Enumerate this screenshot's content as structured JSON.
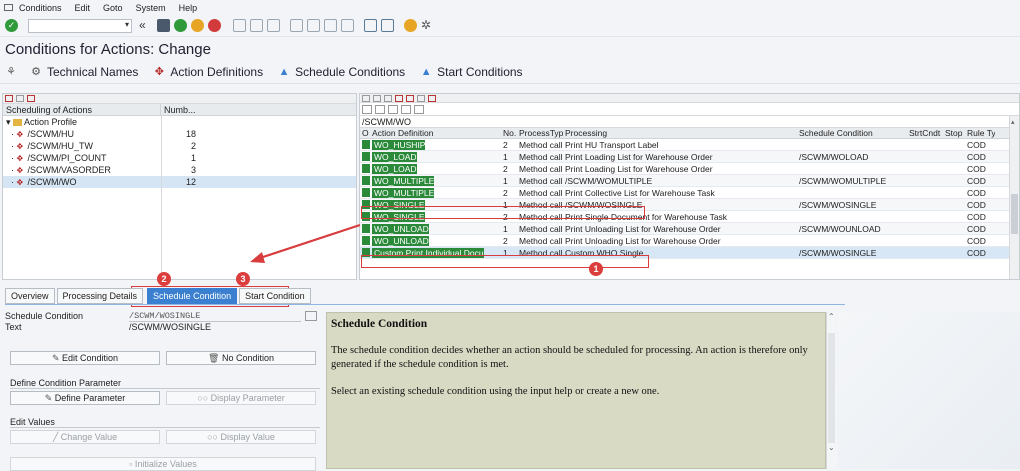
{
  "menu": [
    "Conditions",
    "Edit",
    "Goto",
    "System",
    "Help"
  ],
  "page_title": "Conditions for Actions: Change",
  "app_toolbar": [
    {
      "label": "Technical Names",
      "icon": "technical-names-icon"
    },
    {
      "label": "Action Definitions",
      "icon": "action-definitions-icon"
    },
    {
      "label": "Schedule Conditions",
      "icon": "schedule-conditions-icon"
    },
    {
      "label": "Start Conditions",
      "icon": "start-conditions-icon"
    }
  ],
  "tree": {
    "col1": "Scheduling of Actions",
    "col2": "Numb...",
    "root": "Action Profile",
    "items": [
      {
        "label": "/SCWM/HU",
        "count": "18"
      },
      {
        "label": "/SCWM/HU_TW",
        "count": "2"
      },
      {
        "label": "/SCWM/PI_COUNT",
        "count": "1"
      },
      {
        "label": "/SCWM/VASORDER",
        "count": "3"
      },
      {
        "label": "/SCWM/WO",
        "count": "12"
      }
    ]
  },
  "grid": {
    "profile": "/SCWM/WO",
    "headers": [
      "O",
      "Action Definition",
      "No.",
      "ProcessTyp",
      "Processing",
      "Schedule Condition",
      "StrtCndt",
      "Stop",
      "Rule Ty"
    ],
    "rows": [
      {
        "ad": "WO_HUSHIP",
        "no": "2",
        "pt": "Method call",
        "pr": "Print HU Transport Label",
        "sc": "",
        "rt": "COD"
      },
      {
        "ad": "WO_LOAD",
        "no": "1",
        "pt": "Method call",
        "pr": "Print Loading List for Warehouse Order",
        "sc": "/SCWM/WOLOAD",
        "rt": "COD"
      },
      {
        "ad": "WO_LOAD",
        "no": "2",
        "pt": "Method call",
        "pr": "Print Loading List for Warehouse Order",
        "sc": "",
        "rt": "COD"
      },
      {
        "ad": "WO_MULTIPLE",
        "no": "1",
        "pt": "Method call",
        "pr": "/SCWM/WOMULTIPLE",
        "sc": "/SCWM/WOMULTIPLE",
        "rt": "COD"
      },
      {
        "ad": "WO_MULTIPLE",
        "no": "2",
        "pt": "Method call",
        "pr": "Print Collective List for Warehouse Task",
        "sc": "",
        "rt": "COD"
      },
      {
        "ad": "WO_SINGLE",
        "no": "1",
        "pt": "Method call",
        "pr": "/SCWM/WOSINGLE",
        "sc": "/SCWM/WOSINGLE",
        "rt": "COD"
      },
      {
        "ad": "WO_SINGLE",
        "no": "2",
        "pt": "Method call",
        "pr": "Print Single Document for Warehouse Task",
        "sc": "",
        "rt": "COD"
      },
      {
        "ad": "WO_UNLOAD",
        "no": "1",
        "pt": "Method call",
        "pr": "Print Unloading List for Warehouse Order",
        "sc": "/SCWM/WOUNLOAD",
        "rt": "COD"
      },
      {
        "ad": "WO_UNLOAD",
        "no": "2",
        "pt": "Method call",
        "pr": "Print Unloading List for Warehouse Order",
        "sc": "",
        "rt": "COD"
      },
      {
        "ad": "Custom Print Individual Docu",
        "no": "1",
        "pt": "Method call",
        "pr": "Custom WHO Single",
        "sc": "/SCWM/WOSINGLE",
        "rt": "COD"
      }
    ]
  },
  "badges": [
    "1",
    "2",
    "3"
  ],
  "tabs": [
    {
      "label": "Overview"
    },
    {
      "label": "Processing Details"
    },
    {
      "label": "Schedule Condition"
    },
    {
      "label": "Start Condition"
    }
  ],
  "form": {
    "schedule_condition_label": "Schedule Condition",
    "schedule_condition_value": "/SCWM/WOSINGLE",
    "text_label": "Text",
    "text_value": "/SCWM/WOSINGLE",
    "edit_condition": "Edit Condition",
    "no_condition": "No Condition",
    "define_param_section": "Define Condition Parameter",
    "define_parameter": "Define Parameter",
    "display_parameter": "Display Parameter",
    "edit_values_section": "Edit Values",
    "change_value": "Change Value",
    "display_value": "Display Value",
    "initialize_values": "Initialize Values"
  },
  "help": {
    "title": "Schedule Condition",
    "p1": "The schedule condition decides whether an action should be scheduled for processing. An action is therefore only generated if the schedule condition is met.",
    "p2": "Select an existing schedule condition using the input help or create a new one."
  },
  "colors": {
    "accent": "#3a7fd0",
    "highlight": "#d83c3c",
    "status_green": "#2a8a3a",
    "help_bg": "#d8dac4"
  }
}
